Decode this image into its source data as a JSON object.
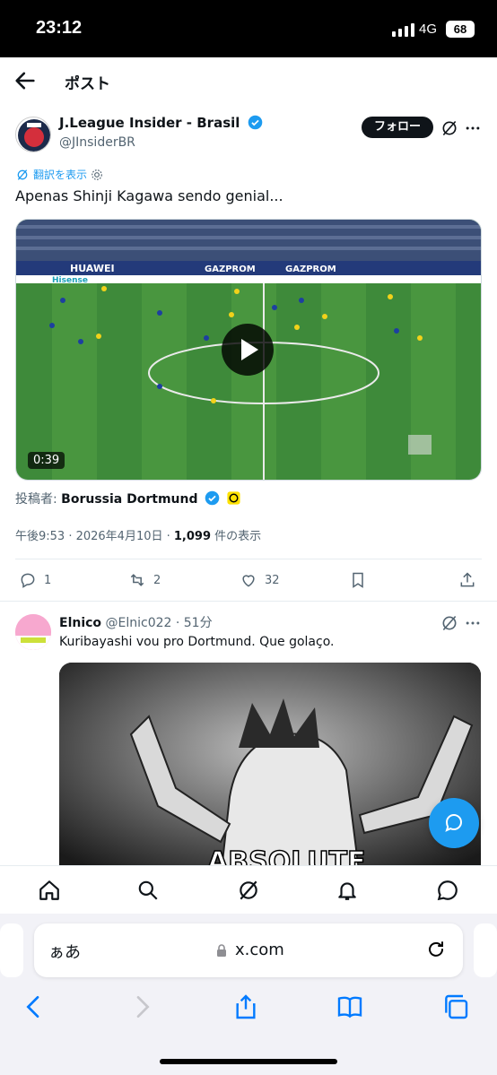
{
  "status_bar": {
    "time": "23:12",
    "network": "4G",
    "battery": "68"
  },
  "top_nav": {
    "title": "ポスト"
  },
  "post": {
    "author_name": "J.League Insider - Brasil",
    "author_handle": "@JInsiderBR",
    "follow_label": "フォロー",
    "translate_label": "翻訳を表示",
    "text": "Apenas Shinji Kagawa sendo genial...",
    "video_duration": "0:39",
    "posted_by_prefix": "投稿者:",
    "posted_by_name": "Borussia Dortmund",
    "timestamp": "午後9:53 · 2026年4月10日 · ",
    "views_count": "1,099",
    "views_suffix": " 件の表示",
    "replies": "1",
    "reposts": "2",
    "likes": "32",
    "video_ads": [
      "HUAWEI",
      "GAZPROM",
      "GAZPROM",
      "Hisense"
    ]
  },
  "reply": {
    "author_name": "Elnico",
    "meta": "@Elnic022 · 51分",
    "text": "Kuribayashi vou pro Dortmund. Que golaço.",
    "media_caption": "ABSOLUTE"
  },
  "browser": {
    "aa_label": "ぁあ",
    "host": "x.com"
  },
  "colors": {
    "accent": "#1d9bf0",
    "text": "#0f1419",
    "muted": "#536471"
  }
}
